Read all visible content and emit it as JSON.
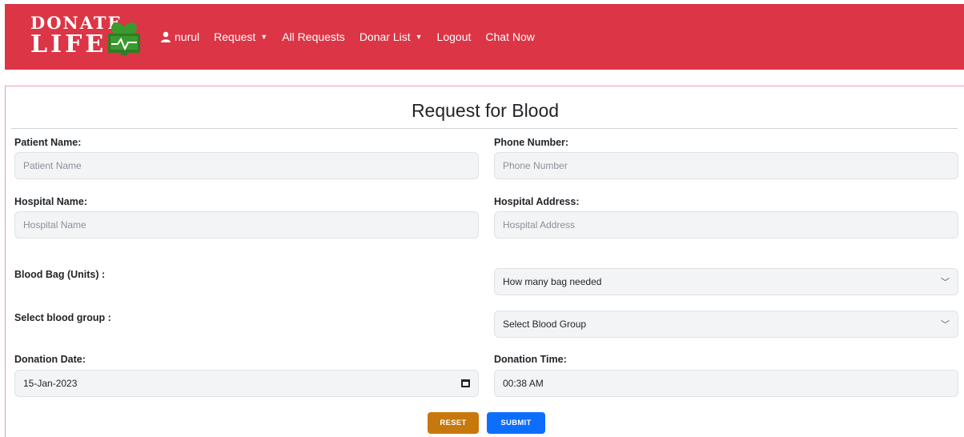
{
  "brand": {
    "line1": "DONATE",
    "line2": "LIFE"
  },
  "nav": {
    "user": "nurul",
    "items": [
      {
        "label": "Request",
        "dropdown": true
      },
      {
        "label": "All Requests",
        "dropdown": false
      },
      {
        "label": "Donar List",
        "dropdown": true
      },
      {
        "label": "Logout",
        "dropdown": false
      },
      {
        "label": "Chat Now",
        "dropdown": false
      }
    ]
  },
  "form": {
    "title": "Request for Blood",
    "patient_name": {
      "label": "Patient Name:",
      "placeholder": "Patient Name"
    },
    "phone_number": {
      "label": "Phone Number:",
      "placeholder": "Phone Number"
    },
    "hospital_name": {
      "label": "Hospital Name:",
      "placeholder": "Hospital Name"
    },
    "hospital_address": {
      "label": "Hospital Address:",
      "placeholder": "Hospital Address"
    },
    "blood_bag": {
      "label": "Blood Bag (Units) :",
      "selected": "How many bag needed"
    },
    "blood_group": {
      "label": "Select blood group :",
      "selected": "Select Blood Group"
    },
    "donation_date": {
      "label": "Donation Date:",
      "value": "15-Jan-2023"
    },
    "donation_time": {
      "label": "Donation Time:",
      "value": "00:38 AM"
    },
    "reset_label": "RESET",
    "submit_label": "SUBMIT"
  },
  "colors": {
    "navbar": "#dc3545",
    "logo_green": "#3a9a2e",
    "reset": "#c7780c",
    "submit": "#0d6efd"
  }
}
